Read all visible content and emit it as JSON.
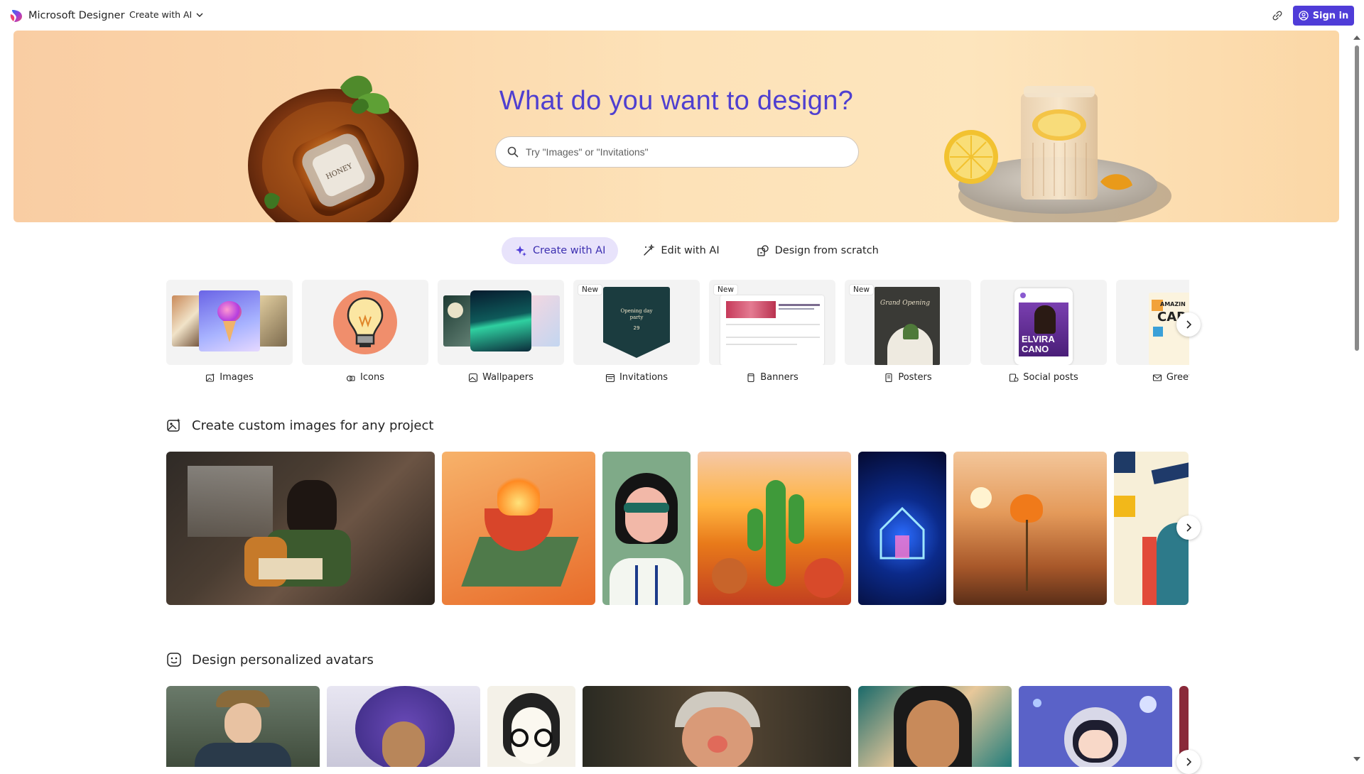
{
  "header": {
    "brand": "Microsoft Designer",
    "create_menu": "Create with AI",
    "sign_in": "Sign in"
  },
  "hero": {
    "title": "What do you want to design?",
    "search_placeholder": "Try \"Images\" or \"Invitations\""
  },
  "modes": [
    {
      "label": "Create with AI",
      "icon": "sparkle-icon",
      "active": true
    },
    {
      "label": "Edit with AI",
      "icon": "magic-wand-icon",
      "active": false
    },
    {
      "label": "Design from scratch",
      "icon": "shapes-icon",
      "active": false
    }
  ],
  "categories": [
    {
      "label": "Images",
      "icon": "image-sparkle-icon",
      "badge": ""
    },
    {
      "label": "Icons",
      "icon": "shapes-sparkle-icon",
      "badge": ""
    },
    {
      "label": "Wallpapers",
      "icon": "wallpaper-icon",
      "badge": ""
    },
    {
      "label": "Invitations",
      "icon": "calendar-icon",
      "badge": "New"
    },
    {
      "label": "Banners",
      "icon": "banner-icon",
      "badge": "New"
    },
    {
      "label": "Posters",
      "icon": "poster-icon",
      "badge": "New"
    },
    {
      "label": "Social posts",
      "icon": "social-icon",
      "badge": ""
    },
    {
      "label": "Greeting",
      "icon": "mail-icon",
      "badge": ""
    }
  ],
  "invitation_card": {
    "line1": "Opening day",
    "line2": "party",
    "date": "29"
  },
  "poster_card": {
    "title": "Grand Opening"
  },
  "social_card": {
    "name_line1": "ELVIRA",
    "name_line2": "CANO"
  },
  "greeting_card": {
    "text1": "AMAZIN",
    "text2": "CAR"
  },
  "sections": {
    "images_title": "Create custom images for any project",
    "avatars_title": "Design personalized avatars"
  },
  "colors": {
    "accent": "#4f3cd8",
    "title": "#4f3fd0",
    "active_mode_bg": "#e8e3fb"
  }
}
